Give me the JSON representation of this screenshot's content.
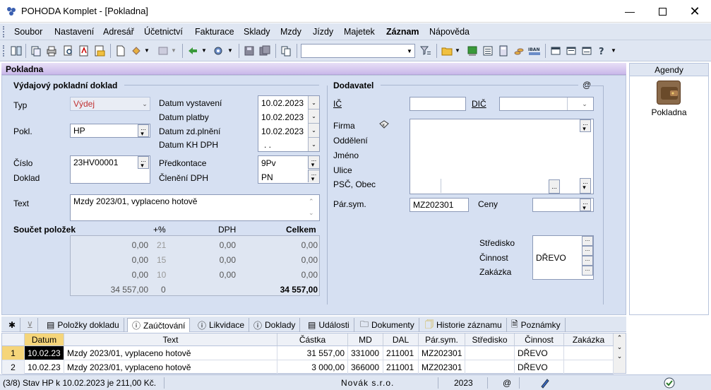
{
  "window": {
    "title": "POHODA Komplet - [Pokladna]"
  },
  "menu": [
    "Soubor",
    "Nastavení",
    "Adresář",
    "Účetnictví",
    "Fakturace",
    "Sklady",
    "Mzdy",
    "Jízdy",
    "Majetek",
    "Záznam",
    "Nápověda"
  ],
  "panel": {
    "title": "Pokladna"
  },
  "doc": {
    "section": "Výdajový pokladní doklad",
    "typ_label": "Typ",
    "typ": "Výdej",
    "pokl_label": "Pokl.",
    "pokl": "HP",
    "cislo_label": "Číslo",
    "doklad_label": "Doklad",
    "cislo": "23HV00001",
    "text_label": "Text",
    "text": "Mzdy 2023/01, vyplaceno hotově",
    "datum_vystaveni_label": "Datum vystavení",
    "datum_vystaveni": "10.02.2023",
    "datum_platby_label": "Datum platby",
    "datum_platby": "10.02.2023",
    "datum_zd_label": "Datum zd.plnění",
    "datum_zd": "10.02.2023",
    "datum_kh_label": "Datum KH DPH",
    "datum_kh": ". .",
    "predkontace_label": "Předkontace",
    "predkontace": "9Pv",
    "cleneni_label": "Členění DPH",
    "cleneni": "PN"
  },
  "soucet": {
    "label": "Součet položek",
    "h_pct": "+%",
    "h_dph": "DPH",
    "h_celkem": "Celkem",
    "rows": [
      {
        "zaklad": "0,00",
        "pct": "21",
        "dph": "0,00",
        "celkem": "0,00"
      },
      {
        "zaklad": "0,00",
        "pct": "15",
        "dph": "0,00",
        "celkem": "0,00"
      },
      {
        "zaklad": "0,00",
        "pct": "10",
        "dph": "0,00",
        "celkem": "0,00"
      },
      {
        "zaklad": "34 557,00",
        "pct": "0",
        "dph": "",
        "celkem": "34 557,00"
      }
    ]
  },
  "dodavatel": {
    "section": "Dodavatel",
    "at": "@",
    "ic_label": "IČ",
    "dic_label": "DIČ",
    "firma_label": "Firma",
    "oddeleni_label": "Oddělení",
    "jmeno_label": "Jméno",
    "ulice_label": "Ulice",
    "psc_label": "PSČ, Obec",
    "parsym_label": "Pár.sym.",
    "parsym": "MZ202301",
    "ceny_label": "Ceny",
    "stredisko_label": "Středisko",
    "cinnost_label": "Činnost",
    "cinnost": "DŘEVO",
    "zakazka_label": "Zakázka"
  },
  "agendy": {
    "title": "Agendy",
    "item": "Pokladna"
  },
  "tabs": [
    "Položky dokladu",
    "Zaúčtování",
    "Likvidace",
    "Doklady",
    "Události",
    "Dokumenty",
    "Historie záznamu",
    "Poznámky"
  ],
  "grid": {
    "headers": [
      "Datum",
      "Text",
      "Částka",
      "MD",
      "DAL",
      "Pár.sym.",
      "Středisko",
      "Činnost",
      "Zakázka"
    ],
    "rows": [
      [
        "1",
        "10.02.23",
        "Mzdy 2023/01, vyplaceno hotově",
        "31 557,00",
        "331000",
        "211001",
        "MZ202301",
        "",
        "DŘEVO",
        ""
      ],
      [
        "2",
        "10.02.23",
        "Mzdy 2023/01, vyplaceno hotově",
        "3 000,00",
        "366000",
        "211001",
        "MZ202301",
        "",
        "DŘEVO",
        ""
      ]
    ]
  },
  "status": {
    "left": "(3/8) Stav HP k 10.02.2023 je 211,00 Kč.",
    "company": "Novák s.r.o.",
    "year": "2023",
    "at": "@"
  }
}
